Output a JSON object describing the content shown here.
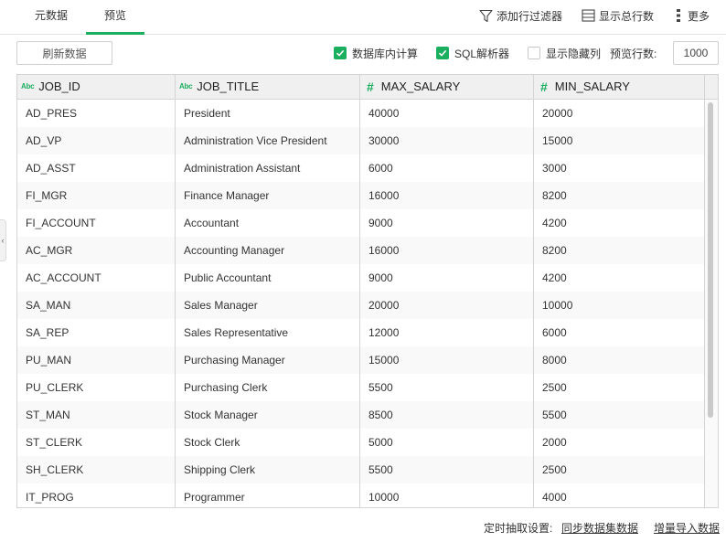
{
  "tabs": [
    {
      "label": "元数据",
      "active": false
    },
    {
      "label": "预览",
      "active": true
    }
  ],
  "toolbar": {
    "add_filter": "添加行过滤器",
    "show_total": "显示总行数",
    "more": "更多"
  },
  "options": {
    "refresh_label": "刷新数据",
    "db_compute": {
      "label": "数据库内计算",
      "checked": true
    },
    "sql_parser": {
      "label": "SQL解析器",
      "checked": true
    },
    "show_hidden": {
      "label": "显示隐藏列",
      "checked": false
    },
    "preview_rows_label": "预览行数:",
    "preview_rows_value": "1000"
  },
  "table": {
    "columns": [
      {
        "name": "JOB_ID",
        "type": "text",
        "type_icon": "Abc"
      },
      {
        "name": "JOB_TITLE",
        "type": "text",
        "type_icon": "Abc"
      },
      {
        "name": "MAX_SALARY",
        "type": "number",
        "type_icon": "#"
      },
      {
        "name": "MIN_SALARY",
        "type": "number",
        "type_icon": "#"
      }
    ],
    "rows": [
      [
        "AD_PRES",
        "President",
        "40000",
        "20000"
      ],
      [
        "AD_VP",
        "Administration Vice President",
        "30000",
        "15000"
      ],
      [
        "AD_ASST",
        "Administration Assistant",
        "6000",
        "3000"
      ],
      [
        "FI_MGR",
        "Finance Manager",
        "16000",
        "8200"
      ],
      [
        "FI_ACCOUNT",
        "Accountant",
        "9000",
        "4200"
      ],
      [
        "AC_MGR",
        "Accounting Manager",
        "16000",
        "8200"
      ],
      [
        "AC_ACCOUNT",
        "Public Accountant",
        "9000",
        "4200"
      ],
      [
        "SA_MAN",
        "Sales Manager",
        "20000",
        "10000"
      ],
      [
        "SA_REP",
        "Sales Representative",
        "12000",
        "6000"
      ],
      [
        "PU_MAN",
        "Purchasing Manager",
        "15000",
        "8000"
      ],
      [
        "PU_CLERK",
        "Purchasing Clerk",
        "5500",
        "2500"
      ],
      [
        "ST_MAN",
        "Stock Manager",
        "8500",
        "5500"
      ],
      [
        "ST_CLERK",
        "Stock Clerk",
        "5000",
        "2000"
      ],
      [
        "SH_CLERK",
        "Shipping Clerk",
        "5500",
        "2500"
      ],
      [
        "IT_PROG",
        "Programmer",
        "10000",
        "4000"
      ]
    ]
  },
  "footer": {
    "schedule_label": "定时抽取设置:",
    "sync_link": "同步数据集数据",
    "incremental_link": "增量导入数据"
  },
  "colors": {
    "accent": "#1aae5f"
  }
}
